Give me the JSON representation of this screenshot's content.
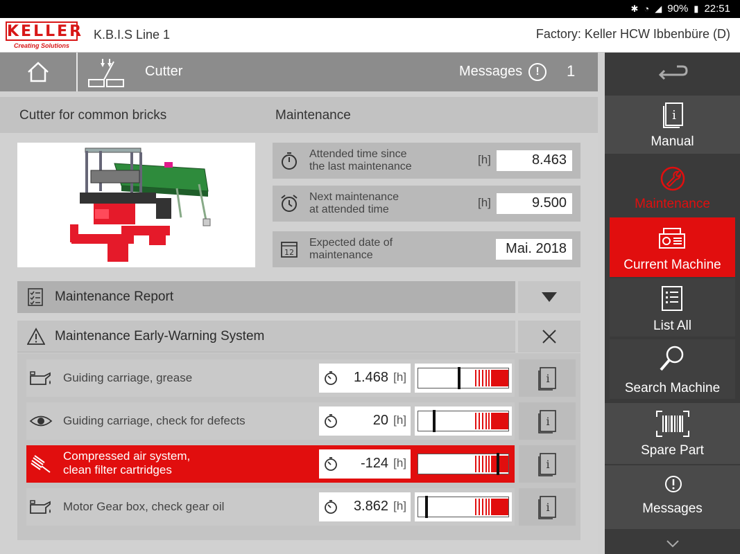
{
  "status_bar": {
    "battery": "90%",
    "time": "22:51"
  },
  "header": {
    "logo_brand": "KELLER",
    "logo_tagline": "Creating Solutions",
    "app_title": "K.B.I.S Line 1",
    "factory": "Factory: Keller HCW Ibbenbüre (D)"
  },
  "topbar": {
    "title": "Cutter",
    "messages_label": "Messages",
    "messages_count": "1"
  },
  "section": {
    "machine_name": "Cutter for common bricks",
    "tab": "Maintenance"
  },
  "maintenance": [
    {
      "label1": "Attended time since",
      "label2": "the last maintenance",
      "unit": "[h]",
      "value": "8.463",
      "icon": "stopwatch-icon"
    },
    {
      "label1": "Next maintenance",
      "label2": "at attended time",
      "unit": "[h]",
      "value": "9.500",
      "icon": "alarm-clock-icon"
    },
    {
      "label1": "Expected date of",
      "label2": "maintenance",
      "unit": "",
      "value": "Mai. 2018",
      "icon": "calendar-icon",
      "calendar_day": "12"
    }
  ],
  "report": {
    "label": "Maintenance Report"
  },
  "early_warning": {
    "label": "Maintenance Early-Warning System",
    "rows": [
      {
        "label": "Guiding carriage, grease",
        "label2": "",
        "time": "1.468",
        "unit": "[h]",
        "icon": "oil-can-icon",
        "level": 0.44,
        "alert": false
      },
      {
        "label": "Guiding carriage, check for defects",
        "label2": "",
        "time": "20",
        "unit": "[h]",
        "icon": "eye-icon",
        "level": 0.16,
        "alert": false
      },
      {
        "label": "Compressed air system,",
        "label2": "clean filter cartridges",
        "time": "-124",
        "unit": "[h]",
        "icon": "brush-icon",
        "level": 0.87,
        "alert": true
      },
      {
        "label": "Motor Gear box, check gear oil",
        "label2": "",
        "time": "3.862",
        "unit": "[h]",
        "icon": "oil-can-icon",
        "level": 0.08,
        "alert": false
      }
    ]
  },
  "sidebar": {
    "items": [
      {
        "label": "Manual",
        "icon": "manual-icon"
      },
      {
        "label": "Maintenance",
        "icon": "wrench-icon"
      },
      {
        "label": "Current Machine",
        "icon": "machine-icon"
      },
      {
        "label": "List All",
        "icon": "list-icon"
      },
      {
        "label": "Search Machine",
        "icon": "magnifier-icon"
      },
      {
        "label": "Spare Part",
        "icon": "barcode-icon"
      },
      {
        "label": "Messages",
        "icon": "exclamation-icon"
      }
    ]
  },
  "colors": {
    "accent": "#e10e0e",
    "topbar": "#8c8c8c",
    "sidebar": "#3a3a3a"
  }
}
